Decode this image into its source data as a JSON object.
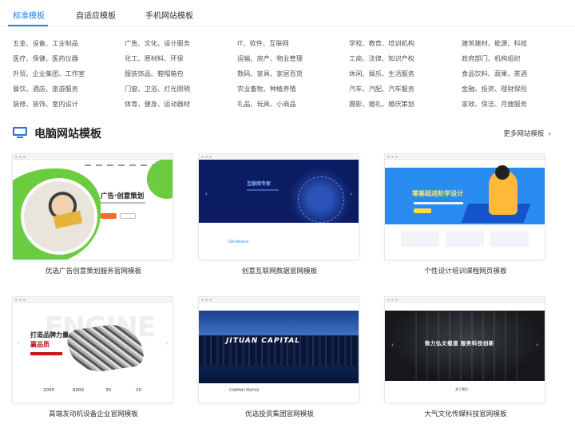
{
  "tabs": [
    {
      "label": "标准模板",
      "active": true
    },
    {
      "label": "自适应模板",
      "active": false
    },
    {
      "label": "手机网站模板",
      "active": false
    }
  ],
  "categories": [
    [
      "五金、设备、工业制品",
      "广告、文化、设计服务",
      "IT、软件、互联网",
      "学校、教育、培训机构",
      "建筑建材、能源、科技"
    ],
    [
      "医疗、保健、医药仪器",
      "化工、原材料、环保",
      "运输、房产、物业管理",
      "工商、法律、知识产权",
      "政府部门、机构组织"
    ],
    [
      "外贸、企业集团、工作室",
      "服装饰品、鞋帽箱包",
      "数码、家具、家居百货",
      "休闲、娱乐、生活服务",
      "食品饮料、蔬果、茶酒"
    ],
    [
      "餐饮、酒店、旅游服务",
      "门窗、卫浴、灯光照明",
      "农业畜牧、种植养殖",
      "汽车、汽配、汽车服务",
      "金融、投资、理财保险"
    ],
    [
      "装修、装饰、室内设计",
      "体育、健身、运动器材",
      "礼品、玩具、小商品",
      "摄影、婚礼、婚庆策划",
      "家政、保洁、月嫂服务"
    ]
  ],
  "section": {
    "icon": "monitor-icon",
    "title": "电脑网站模板",
    "more_label": "更多网站模板",
    "more_icon": "chevron-right-icon"
  },
  "templates": [
    {
      "name": "优选广告创意策划服务官网模板",
      "thumb_headline": "广告·创意策划"
    },
    {
      "name": "创意互联网数据官网模板",
      "thumb_headline": "互联网专家",
      "thumb_footer": "TDH Network"
    },
    {
      "name": "个性设计培训课程网页模板",
      "thumb_headline": "零基础进阶学设计"
    },
    {
      "name": "高端发动机设备企业官网模板",
      "thumb_headline_1": "打造品牌力量",
      "thumb_headline_2": "赢品质",
      "thumb_bg_text": "ENGINE",
      "thumb_stats": [
        "2005",
        "6000",
        "30",
        "20"
      ]
    },
    {
      "name": "优选投资集团官网模板",
      "thumb_headline": "JITUAN CAPITAL",
      "thumb_footer": "COMPANY PROFILE"
    },
    {
      "name": "大气文化传媒科技官网模板",
      "thumb_headline": "致力弘文载道 服务科技创新",
      "thumb_footer": "关于我们"
    }
  ],
  "colors": {
    "accent": "#1e7fe6",
    "text": "#333333",
    "green": "#6ccc3f"
  }
}
